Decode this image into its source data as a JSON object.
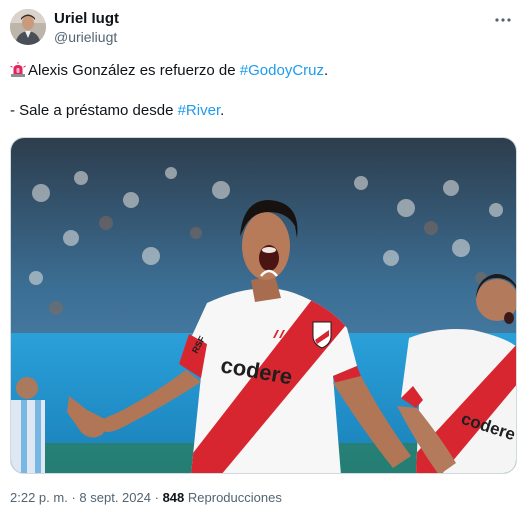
{
  "author": {
    "display_name": "Uriel Iugt",
    "handle": "@urieliugt"
  },
  "tweet": {
    "line1_text": "Alexis González es refuerzo de ",
    "line1_hashtag": "#GodoyCruz",
    "line1_end": ".",
    "line1_emoji": "police-car-light-icon",
    "line2_text": "- Sale a préstamo desde ",
    "line2_hashtag": "#River",
    "line2_end": "."
  },
  "media": {
    "jersey_sponsor": "codere",
    "jersey_sponsor_2": "codere"
  },
  "meta": {
    "time": "2:22 p. m.",
    "separator": "·",
    "date": "8 sept. 2024",
    "views_count": "848",
    "views_label": "Reproducciones"
  },
  "colors": {
    "hashtag": "#1d9bf0",
    "secondary_text": "#536471",
    "river_red": "#d7262f"
  }
}
